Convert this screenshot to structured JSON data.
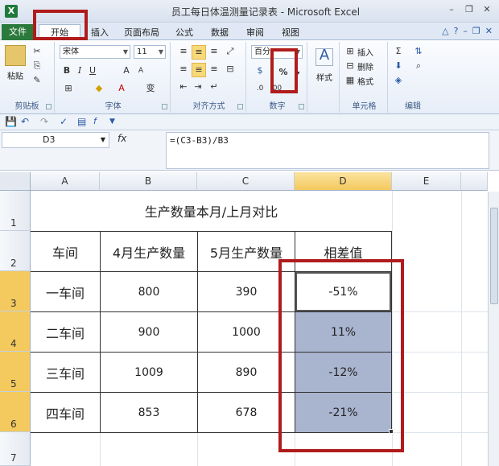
{
  "window": {
    "title": "员工每日体温测量记录表 - Microsoft Excel",
    "app_icon": "X"
  },
  "tabs": [
    {
      "label": "文件"
    },
    {
      "label": "开始"
    },
    {
      "label": "插入"
    },
    {
      "label": "页面布局"
    },
    {
      "label": "公式"
    },
    {
      "label": "数据"
    },
    {
      "label": "审阅"
    },
    {
      "label": "视图"
    }
  ],
  "ribbon": {
    "clipboard": {
      "label": "剪贴板",
      "paste_label": "粘贴"
    },
    "font": {
      "label": "字体",
      "font_name": "宋体",
      "font_size": "11",
      "bold": "B",
      "italic": "I",
      "underline": "U",
      "grow": "A",
      "shrink": "A",
      "phonetic": "变"
    },
    "alignment": {
      "label": "对齐方式"
    },
    "number": {
      "label": "数字",
      "format": "百分",
      "percent": "%",
      "comma": ","
    },
    "styles": {
      "label": "样式"
    },
    "cells": {
      "label": "单元格",
      "insert": "插入",
      "delete": "删除",
      "format": "格式"
    },
    "editing": {
      "label": "编辑",
      "sum": "Σ"
    }
  },
  "formula_bar": {
    "name_box": "D3",
    "fx": "fx",
    "formula": "=(C3-B3)/B3"
  },
  "columns": [
    "A",
    "B",
    "C",
    "D",
    "E"
  ],
  "rows": [
    "1",
    "2",
    "3",
    "4",
    "5",
    "6",
    "7"
  ],
  "sheet": {
    "title": "生产数量本月/上月对比",
    "headers": [
      "车间",
      "4月生产数量",
      "5月生产数量",
      "相差值"
    ],
    "data": [
      [
        "一车间",
        "800",
        "390",
        "-51%"
      ],
      [
        "二车间",
        "900",
        "1000",
        "11%"
      ],
      [
        "三车间",
        "1009",
        "890",
        "-12%"
      ],
      [
        "四车间",
        "853",
        "678",
        "-21%"
      ]
    ]
  },
  "colors": {
    "accent_red": "#b01c1c",
    "selection_blue": "#a9b4cf",
    "excel_green": "#2b7a3c",
    "header_highlight": "#f4c95d"
  }
}
